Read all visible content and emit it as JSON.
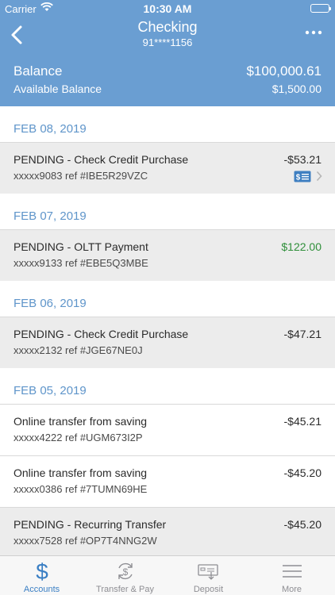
{
  "status_bar": {
    "carrier": "Carrier",
    "time": "10:30 AM"
  },
  "header": {
    "title": "Checking",
    "account_number": "91****1156",
    "balance_label": "Balance",
    "balance_value": "$100,000.61",
    "available_label": "Available Balance",
    "available_value": "$1,500.00"
  },
  "groups": [
    {
      "date": "FEB 08, 2019",
      "transactions": [
        {
          "description": "PENDING - Check Credit Purchase",
          "reference": "xxxxx9083 ref #IBE5R29VZC",
          "amount": "-$53.21"
        }
      ]
    },
    {
      "date": "FEB 07, 2019",
      "transactions": [
        {
          "description": "PENDING - OLTT Payment",
          "reference": "xxxxx9133 ref #EBE5Q3MBE",
          "amount": "$122.00"
        }
      ]
    },
    {
      "date": "FEB 06, 2019",
      "transactions": [
        {
          "description": "PENDING - Check Credit Purchase",
          "reference": "xxxxx2132 ref #JGE67NE0J",
          "amount": "-$47.21"
        }
      ]
    },
    {
      "date": "FEB 05, 2019",
      "transactions": [
        {
          "description": "Online transfer from saving",
          "reference": "xxxxx4222 ref #UGM673I2P",
          "amount": "-$45.21"
        },
        {
          "description": "Online transfer from saving",
          "reference": "xxxxx0386 ref #7TUMN69HE",
          "amount": "-$45.20"
        },
        {
          "description": "PENDING - Recurring Transfer",
          "reference": "xxxxx7528 ref #OP7T4NNG2W",
          "amount": "-$45.20"
        }
      ]
    }
  ],
  "tabs": [
    {
      "label": "Accounts",
      "icon": "dollar-icon"
    },
    {
      "label": "Transfer & Pay",
      "icon": "transfer-pay-icon"
    },
    {
      "label": "Deposit",
      "icon": "deposit-check-icon"
    },
    {
      "label": "More",
      "icon": "hamburger-menu-icon"
    }
  ],
  "colors": {
    "header_bg": "#6a9ed2",
    "date_text": "#5f95ca",
    "pending_row_bg": "#ececec",
    "positive_amount": "#2f8f3a",
    "active_tab": "#3a7fc4"
  }
}
